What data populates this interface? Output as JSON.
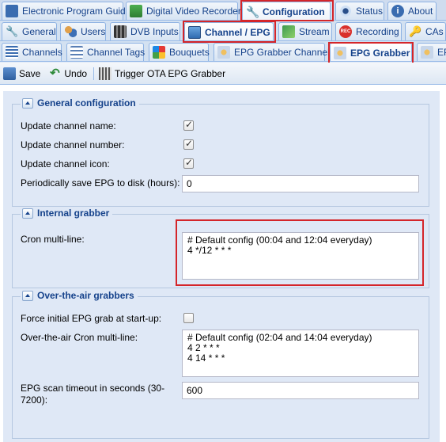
{
  "tabs_row1": [
    {
      "label": "Electronic Program Guide",
      "icon": "epg-icon"
    },
    {
      "label": "Digital Video Recorder",
      "icon": "dvr-icon"
    },
    {
      "label": "Configuration",
      "icon": "wrench-icon",
      "active": true
    },
    {
      "label": "Status",
      "icon": "eye-icon"
    },
    {
      "label": "About",
      "icon": "info-icon"
    }
  ],
  "tabs_row2": [
    {
      "label": "General",
      "icon": "wrench-icon"
    },
    {
      "label": "Users",
      "icon": "users-icon"
    },
    {
      "label": "DVB Inputs",
      "icon": "film-icon"
    },
    {
      "label": "Channel / EPG",
      "icon": "tv-icon",
      "active": true
    },
    {
      "label": "Stream",
      "icon": "stream-icon"
    },
    {
      "label": "Recording",
      "icon": "rec-icon"
    },
    {
      "label": "CAs",
      "icon": "key-icon"
    }
  ],
  "tabs_row3": [
    {
      "label": "Channels",
      "icon": "list-icon"
    },
    {
      "label": "Channel Tags",
      "icon": "tag-icon"
    },
    {
      "label": "Bouquets",
      "icon": "bouquet-icon"
    },
    {
      "label": "EPG Grabber Channels",
      "icon": "grabber-icon"
    },
    {
      "label": "EPG Grabber",
      "icon": "grabber-icon",
      "active": true
    },
    {
      "label": "EP",
      "icon": "grabber-icon"
    }
  ],
  "toolbar": {
    "save": "Save",
    "undo": "Undo",
    "trigger": "Trigger OTA EPG Grabber"
  },
  "general": {
    "title": "General configuration",
    "update_name": "Update channel name:",
    "update_number": "Update channel number:",
    "update_icon": "Update channel icon:",
    "save_period_label": "Periodically save EPG to disk (hours):",
    "save_period_value": "0",
    "update_name_checked": true,
    "update_number_checked": true,
    "update_icon_checked": true
  },
  "internal": {
    "title": "Internal grabber",
    "cron_label": "Cron multi-line:",
    "cron_value": "# Default config (00:04 and 12:04 everyday)\n4 */12 * * *"
  },
  "ota": {
    "title": "Over-the-air grabbers",
    "force_label": "Force initial EPG grab at start-up:",
    "force_checked": false,
    "cron_label": "Over-the-air Cron multi-line:",
    "cron_value": "# Default config (02:04 and 14:04 everyday)\n4 2 * * *\n4 14 * * *",
    "timeout_label": "EPG scan timeout in seconds (30-7200):",
    "timeout_value": "600"
  },
  "colors": {
    "highlight": "#d4252a",
    "accent": "#15428b",
    "background": "#dfe8f6"
  }
}
